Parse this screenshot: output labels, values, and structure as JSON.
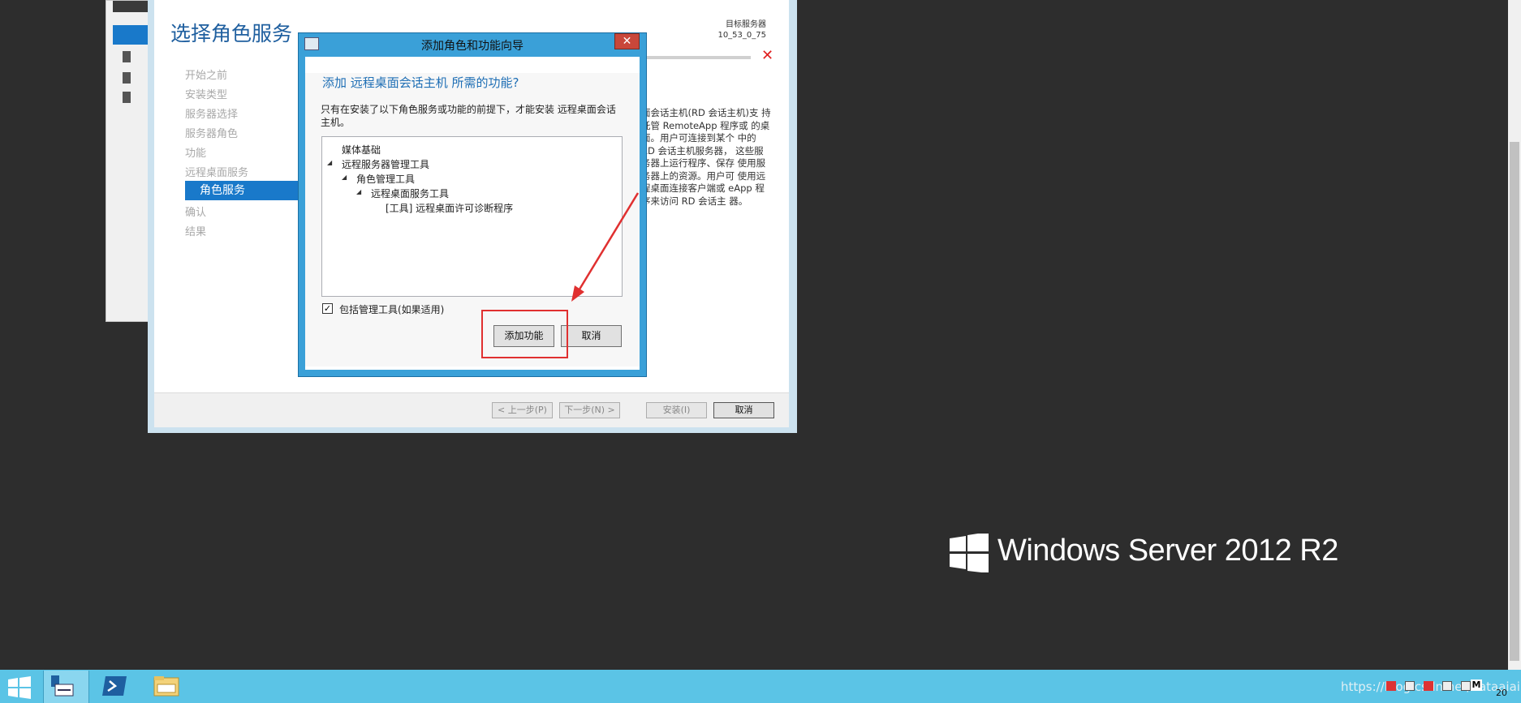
{
  "wizard": {
    "title": "选择角色服务",
    "target_server_label": "目标服务器",
    "target_server_name": "10_53_0_75",
    "steps": [
      "开始之前",
      "安装类型",
      "服务器选择",
      "服务器角色",
      "功能",
      "远程桌面服务",
      "角色服务",
      "确认",
      "结果"
    ],
    "active_step": "角色服务",
    "description": "面会话主机(RD 会话主机)支 持托管 RemoteApp 程序或 的桌面。用户可连接到某个 中的 RD 会话主机服务器， 这些服务器上运行程序、保存 使用服务器上的资源。用户可 使用远程桌面连接客户端或 eApp 程序来访问 RD 会话主 器。",
    "footer_buttons": {
      "prev": "< 上一步(P)",
      "next": "下一步(N) >",
      "install": "安装(I)",
      "cancel": "取消"
    }
  },
  "dialog": {
    "title": "添加角色和功能向导",
    "close": "✕",
    "heading": "添加 远程桌面会话主机 所需的功能?",
    "message": "只有在安装了以下角色服务或功能的前提下，才能安装 远程桌面会话主机。",
    "tree": [
      "媒体基础",
      "远程服务器管理工具",
      "角色管理工具",
      "远程桌面服务工具",
      "[工具] 远程桌面许可诊断程序"
    ],
    "include_tools_label": "包括管理工具(如果适用)",
    "include_tools_checked": true,
    "add_button": "添加功能",
    "cancel_button": "取消"
  },
  "branding": {
    "text": "Windows Server 2012 R2"
  },
  "taskbar": {
    "watermark": "https://blog.csdn.net/dataaiai",
    "clock": "20"
  },
  "colors": {
    "accent": "#1979ca",
    "desktop": "#2d2d2d",
    "taskbar": "#5bc4e6",
    "highlight": "#e03030"
  }
}
